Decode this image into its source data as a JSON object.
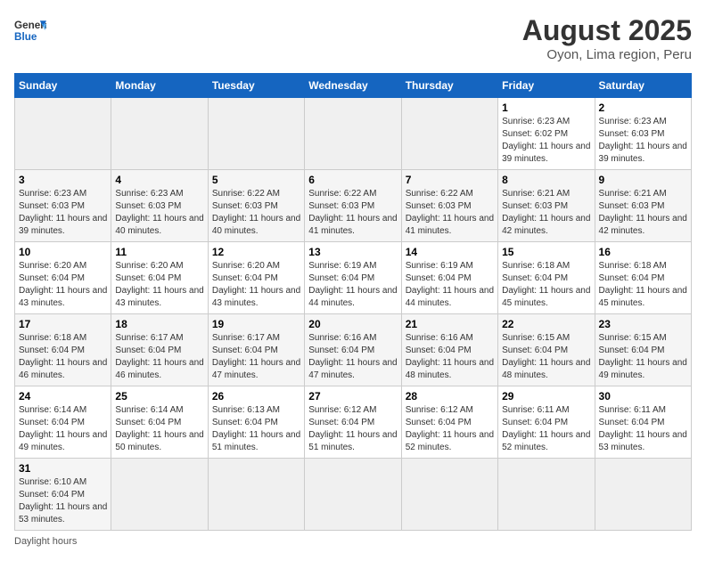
{
  "header": {
    "logo_general": "General",
    "logo_blue": "Blue",
    "title": "August 2025",
    "subtitle": "Oyon, Lima region, Peru"
  },
  "days_of_week": [
    "Sunday",
    "Monday",
    "Tuesday",
    "Wednesday",
    "Thursday",
    "Friday",
    "Saturday"
  ],
  "weeks": [
    [
      {
        "day": "",
        "info": ""
      },
      {
        "day": "",
        "info": ""
      },
      {
        "day": "",
        "info": ""
      },
      {
        "day": "",
        "info": ""
      },
      {
        "day": "",
        "info": ""
      },
      {
        "day": "1",
        "info": "Sunrise: 6:23 AM\nSunset: 6:02 PM\nDaylight: 11 hours and 39 minutes."
      },
      {
        "day": "2",
        "info": "Sunrise: 6:23 AM\nSunset: 6:03 PM\nDaylight: 11 hours and 39 minutes."
      }
    ],
    [
      {
        "day": "3",
        "info": "Sunrise: 6:23 AM\nSunset: 6:03 PM\nDaylight: 11 hours and 39 minutes."
      },
      {
        "day": "4",
        "info": "Sunrise: 6:23 AM\nSunset: 6:03 PM\nDaylight: 11 hours and 40 minutes."
      },
      {
        "day": "5",
        "info": "Sunrise: 6:22 AM\nSunset: 6:03 PM\nDaylight: 11 hours and 40 minutes."
      },
      {
        "day": "6",
        "info": "Sunrise: 6:22 AM\nSunset: 6:03 PM\nDaylight: 11 hours and 41 minutes."
      },
      {
        "day": "7",
        "info": "Sunrise: 6:22 AM\nSunset: 6:03 PM\nDaylight: 11 hours and 41 minutes."
      },
      {
        "day": "8",
        "info": "Sunrise: 6:21 AM\nSunset: 6:03 PM\nDaylight: 11 hours and 42 minutes."
      },
      {
        "day": "9",
        "info": "Sunrise: 6:21 AM\nSunset: 6:03 PM\nDaylight: 11 hours and 42 minutes."
      }
    ],
    [
      {
        "day": "10",
        "info": "Sunrise: 6:20 AM\nSunset: 6:04 PM\nDaylight: 11 hours and 43 minutes."
      },
      {
        "day": "11",
        "info": "Sunrise: 6:20 AM\nSunset: 6:04 PM\nDaylight: 11 hours and 43 minutes."
      },
      {
        "day": "12",
        "info": "Sunrise: 6:20 AM\nSunset: 6:04 PM\nDaylight: 11 hours and 43 minutes."
      },
      {
        "day": "13",
        "info": "Sunrise: 6:19 AM\nSunset: 6:04 PM\nDaylight: 11 hours and 44 minutes."
      },
      {
        "day": "14",
        "info": "Sunrise: 6:19 AM\nSunset: 6:04 PM\nDaylight: 11 hours and 44 minutes."
      },
      {
        "day": "15",
        "info": "Sunrise: 6:18 AM\nSunset: 6:04 PM\nDaylight: 11 hours and 45 minutes."
      },
      {
        "day": "16",
        "info": "Sunrise: 6:18 AM\nSunset: 6:04 PM\nDaylight: 11 hours and 45 minutes."
      }
    ],
    [
      {
        "day": "17",
        "info": "Sunrise: 6:18 AM\nSunset: 6:04 PM\nDaylight: 11 hours and 46 minutes."
      },
      {
        "day": "18",
        "info": "Sunrise: 6:17 AM\nSunset: 6:04 PM\nDaylight: 11 hours and 46 minutes."
      },
      {
        "day": "19",
        "info": "Sunrise: 6:17 AM\nSunset: 6:04 PM\nDaylight: 11 hours and 47 minutes."
      },
      {
        "day": "20",
        "info": "Sunrise: 6:16 AM\nSunset: 6:04 PM\nDaylight: 11 hours and 47 minutes."
      },
      {
        "day": "21",
        "info": "Sunrise: 6:16 AM\nSunset: 6:04 PM\nDaylight: 11 hours and 48 minutes."
      },
      {
        "day": "22",
        "info": "Sunrise: 6:15 AM\nSunset: 6:04 PM\nDaylight: 11 hours and 48 minutes."
      },
      {
        "day": "23",
        "info": "Sunrise: 6:15 AM\nSunset: 6:04 PM\nDaylight: 11 hours and 49 minutes."
      }
    ],
    [
      {
        "day": "24",
        "info": "Sunrise: 6:14 AM\nSunset: 6:04 PM\nDaylight: 11 hours and 49 minutes."
      },
      {
        "day": "25",
        "info": "Sunrise: 6:14 AM\nSunset: 6:04 PM\nDaylight: 11 hours and 50 minutes."
      },
      {
        "day": "26",
        "info": "Sunrise: 6:13 AM\nSunset: 6:04 PM\nDaylight: 11 hours and 51 minutes."
      },
      {
        "day": "27",
        "info": "Sunrise: 6:12 AM\nSunset: 6:04 PM\nDaylight: 11 hours and 51 minutes."
      },
      {
        "day": "28",
        "info": "Sunrise: 6:12 AM\nSunset: 6:04 PM\nDaylight: 11 hours and 52 minutes."
      },
      {
        "day": "29",
        "info": "Sunrise: 6:11 AM\nSunset: 6:04 PM\nDaylight: 11 hours and 52 minutes."
      },
      {
        "day": "30",
        "info": "Sunrise: 6:11 AM\nSunset: 6:04 PM\nDaylight: 11 hours and 53 minutes."
      }
    ],
    [
      {
        "day": "31",
        "info": "Sunrise: 6:10 AM\nSunset: 6:04 PM\nDaylight: 11 hours and 53 minutes."
      },
      {
        "day": "",
        "info": ""
      },
      {
        "day": "",
        "info": ""
      },
      {
        "day": "",
        "info": ""
      },
      {
        "day": "",
        "info": ""
      },
      {
        "day": "",
        "info": ""
      },
      {
        "day": "",
        "info": ""
      }
    ]
  ],
  "footer": {
    "daylight_label": "Daylight hours"
  }
}
